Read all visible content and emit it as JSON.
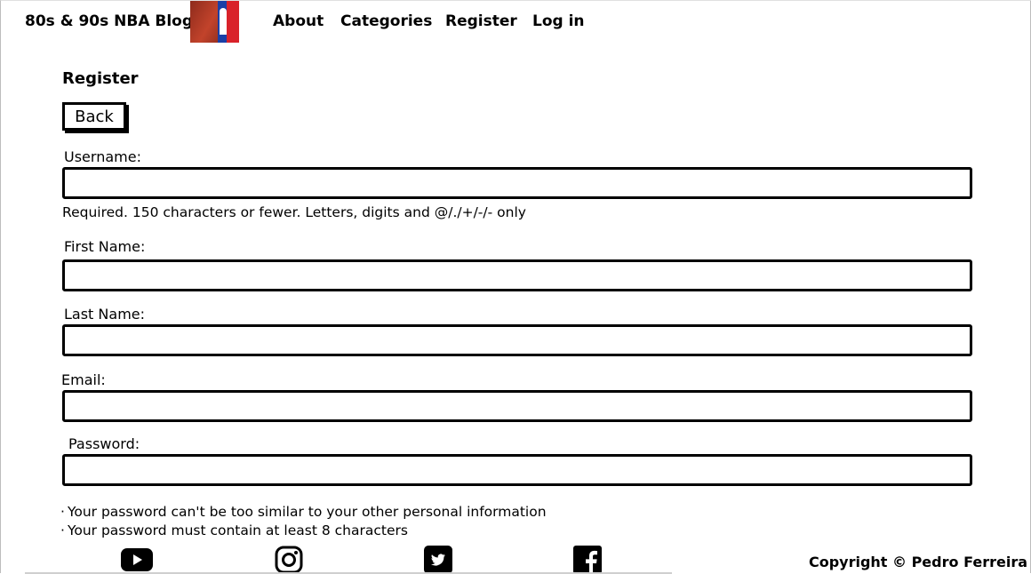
{
  "navbar": {
    "brand": "80s & 90s NBA Blog",
    "logo_name": "nba-logo",
    "links": [
      "About",
      "Categories",
      "Register",
      "Log in"
    ]
  },
  "page": {
    "title": "Register",
    "back_label": "Back"
  },
  "form": {
    "username": {
      "label": "Username:",
      "value": ""
    },
    "username_help": "Required. 150 characters or fewer. Letters, digits and @/./+/-/- only",
    "first_name": {
      "label": "First Name:",
      "value": ""
    },
    "last_name": {
      "label": "Last Name:",
      "value": ""
    },
    "email": {
      "label": "Email:",
      "value": ""
    },
    "password": {
      "label": "Password:",
      "value": ""
    },
    "password_rules": [
      "Your password can't be too similar to your other personal information",
      "Your password must contain at least 8 characters"
    ]
  },
  "footer": {
    "social": [
      "youtube-icon",
      "instagram-icon",
      "twitter-icon",
      "facebook-icon"
    ],
    "copyright": "Copyright © Pedro Ferreira"
  }
}
